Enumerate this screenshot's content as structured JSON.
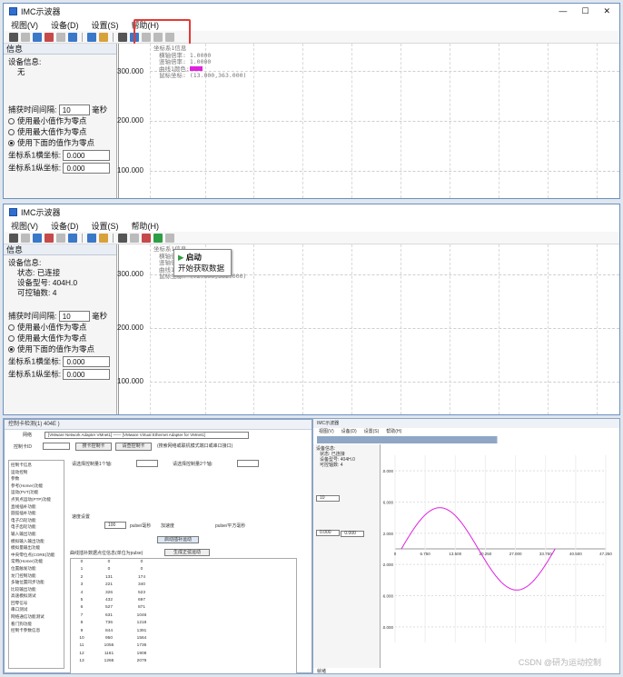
{
  "win1": {
    "title": "IMC示波器",
    "menu": [
      "视图(V)",
      "设备(D)",
      "设置(S)",
      "帮助(H)"
    ],
    "panel_title": "信息",
    "device_label": "设备信息:",
    "device_value": "无",
    "interval_label": "捕获时间间隔:",
    "interval_value": "10",
    "interval_unit": "毫秒",
    "radios": [
      "使用最小值作为零点",
      "使用最大值作为零点",
      "使用下面的值作为零点"
    ],
    "coord_h_label": "坐标系1横坐标:",
    "coord_h_value": "0.000",
    "coord_v_label": "坐标系1纵坐标:",
    "coord_v_value": "0.000",
    "y_ticks": [
      "300.000",
      "200.000",
      "100.000"
    ],
    "info_lines": [
      "坐标系1信息",
      "横轴倍率: 1.0000",
      "竖轴倍率: 1.0000",
      "曲线1颜色:",
      "鼠标坐标: (13.000,363.000)"
    ]
  },
  "win2": {
    "title": "IMC示波器",
    "menu": [
      "视图(V)",
      "设备(D)",
      "设置(S)",
      "帮助(H)"
    ],
    "panel_title": "信息",
    "device_label": "设备信息:",
    "device_lines": [
      "状态: 已连接",
      "设备型号: 404H.0",
      "可控轴数: 4"
    ],
    "interval_label": "捕获时间间隔:",
    "interval_value": "10",
    "interval_unit": "毫秒",
    "radios": [
      "使用最小值作为零点",
      "使用最大值作为零点",
      "使用下面的值作为零点"
    ],
    "coord_h_label": "坐标系1横坐标:",
    "coord_h_value": "0.000",
    "coord_v_label": "坐标系1纵坐标:",
    "coord_v_value": "0.000",
    "y_ticks": [
      "300.000",
      "200.000",
      "100.000"
    ],
    "popup_title": "启动",
    "popup_desc": "开始获取数据",
    "info_lines": [
      "坐标系1信息",
      "横轴倍率",
      "竖轴倍率",
      "曲线1颜色",
      "鼠标坐标: (72.000,362.000)"
    ]
  },
  "win3": {
    "title": "控制卡检测(1) 404E )",
    "net_label": "网络",
    "net_value": "[VMware Network Adapter VMnet1] —— [VMware Virtual Ethernet Adapter for VMnet1]",
    "ctrl_label": "控制卡ID",
    "btn_open": "搜卡控制卡",
    "btn_close": "请查控制卡",
    "hint": "(搜索网络或联机模式端口或串口接口)",
    "sidebar": [
      "控制卡信息",
      "运动控制",
      "参数",
      "参考(Homer)功能",
      "运动(PVT)功能",
      "点到点运动(PTP)功能",
      "直线插补功能",
      "圆弧插补功能",
      "电子凸轮功能",
      "电子齿轮功能",
      "输入输出功能",
      "模拟输入输出功能",
      "模拟量输出功能",
      "中央零位点(CORE)功能",
      "常用(Homer)功能",
      "位置触发功能",
      "龙门控制功能",
      "多轴位置同步功能",
      "比较输出功能",
      "高速模拟测试",
      "回零信号",
      "串口测试",
      "网络通信功能测试",
      "看门狗功能",
      "控制卡参数信息"
    ],
    "axis_label1": "请选择控制量1个轴:",
    "axis_label2": "请选择控制量2个轴:",
    "speed_label": "速度设置",
    "speed_value": "100",
    "speed_unit": "pulse/毫秒",
    "acc_label": "加速度",
    "acc_unit": "pulse/平方毫秒",
    "btn_start": "启动插补运动",
    "btn_clear": "生成正弦运动",
    "table_label": "曲线插补数据点位信息(单位为pulse)",
    "table_rows": [
      [
        "0",
        "0",
        "0"
      ],
      [
        "1",
        "0",
        "0"
      ],
      [
        "2",
        "131",
        "174"
      ],
      [
        "3",
        "221",
        "340"
      ],
      [
        "4",
        "326",
        "523"
      ],
      [
        "5",
        "432",
        "697"
      ],
      [
        "6",
        "527",
        "871"
      ],
      [
        "7",
        "631",
        "1046"
      ],
      [
        "8",
        "736",
        "1218"
      ],
      [
        "9",
        "844",
        "1391"
      ],
      [
        "10",
        "950",
        "1564"
      ],
      [
        "11",
        "1055",
        "1736"
      ],
      [
        "12",
        "1161",
        "1908"
      ],
      [
        "13",
        "1266",
        "2079"
      ]
    ]
  },
  "win4": {
    "title": "IMC示波器",
    "menu": [
      "视图(V)",
      "设备(D)",
      "设置(S)",
      "帮助(H)"
    ],
    "device_lines": [
      "设备信息:",
      "状态: 已连接",
      "设备型号: 404H.0",
      "可控轴数: 4"
    ],
    "interval_value": "10",
    "coord_h": "0.000",
    "coord_v": "0.000",
    "y_ticks": [
      "10.000",
      "6.000",
      "2.000",
      "-2.000",
      "-6.000",
      "-10.000"
    ],
    "x_ticks": [
      "0",
      "6.750",
      "13.500",
      "20.250",
      "27.000",
      "33.750",
      "40.500",
      "47.250"
    ],
    "status": "就绪"
  },
  "watermark": "CSDN @研为运动控制",
  "colors": {
    "highlight": "#e53935",
    "curve": "#e020e0",
    "accent": "#2f6fd1"
  }
}
